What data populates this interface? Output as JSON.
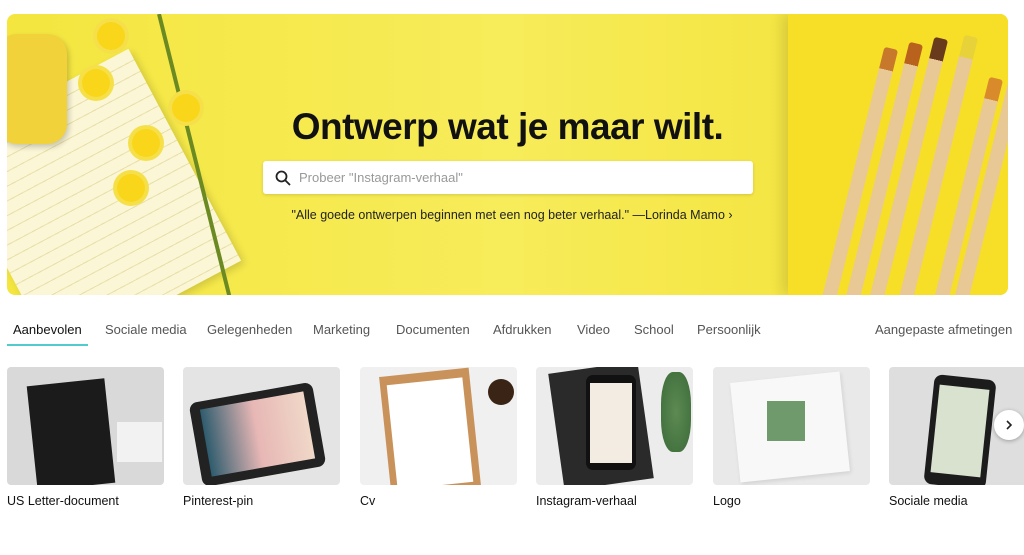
{
  "hero": {
    "title": "Ontwerp wat je maar wilt.",
    "search_placeholder": "Probeer \"Instagram-verhaal\"",
    "quote": "\"Alle goede ontwerpen beginnen met een nog beter verhaal.\" —Lorinda Mamo ›",
    "accent_color": "#f4e63f"
  },
  "tabs": {
    "items": [
      {
        "label": "Aanbevolen",
        "active": true
      },
      {
        "label": "Sociale media"
      },
      {
        "label": "Gelegenheden"
      },
      {
        "label": "Marketing"
      },
      {
        "label": "Documenten"
      },
      {
        "label": "Afdrukken"
      },
      {
        "label": "Video"
      },
      {
        "label": "School"
      },
      {
        "label": "Persoonlijk"
      }
    ],
    "custom_size": "Aangepaste afmetingen",
    "active_color": "#4fcccb"
  },
  "cards": [
    {
      "label": "US Letter-document"
    },
    {
      "label": "Pinterest-pin"
    },
    {
      "label": "Cv"
    },
    {
      "label": "Instagram-verhaal"
    },
    {
      "label": "Logo"
    },
    {
      "label": "Sociale media"
    }
  ],
  "next_icon": "chevron-right-icon"
}
